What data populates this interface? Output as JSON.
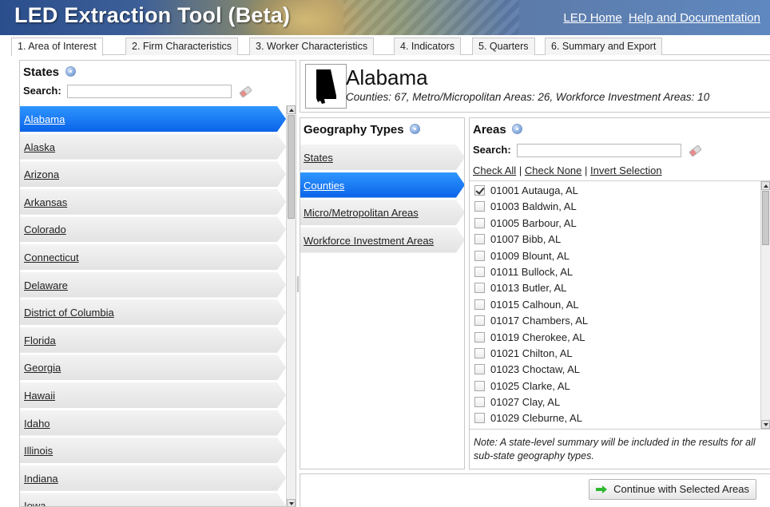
{
  "app": {
    "title": "LED Extraction Tool (Beta)",
    "links": [
      {
        "label": "LED Home"
      },
      {
        "label": "Help and Documentation"
      }
    ]
  },
  "tabs": [
    {
      "label": "1. Area of Interest",
      "active": true
    },
    {
      "label": "2. Firm Characteristics",
      "active": false
    },
    {
      "label": "3. Worker Characteristics",
      "active": false
    },
    {
      "label": "4. Indicators",
      "active": false
    },
    {
      "label": "5. Quarters",
      "active": false
    },
    {
      "label": "6. Summary and Export",
      "active": false
    }
  ],
  "states_panel": {
    "title": "States",
    "search_label": "Search:",
    "search_value": "",
    "items": [
      {
        "label": "Alabama",
        "selected": true
      },
      {
        "label": "Alaska",
        "selected": false
      },
      {
        "label": "Arizona",
        "selected": false
      },
      {
        "label": "Arkansas",
        "selected": false
      },
      {
        "label": "Colorado",
        "selected": false
      },
      {
        "label": "Connecticut",
        "selected": false
      },
      {
        "label": "Delaware",
        "selected": false
      },
      {
        "label": "District of Columbia",
        "selected": false
      },
      {
        "label": "Florida",
        "selected": false
      },
      {
        "label": "Georgia",
        "selected": false
      },
      {
        "label": "Hawaii",
        "selected": false
      },
      {
        "label": "Idaho",
        "selected": false
      },
      {
        "label": "Illinois",
        "selected": false
      },
      {
        "label": "Indiana",
        "selected": false
      },
      {
        "label": "Iowa",
        "selected": false
      }
    ]
  },
  "selected_state": {
    "name": "Alabama",
    "meta": "Counties: 67, Metro/Micropolitan Areas: 26, Workforce Investment Areas: 10"
  },
  "geography_types": {
    "title": "Geography Types",
    "items": [
      {
        "label": "States",
        "selected": false
      },
      {
        "label": "Counties",
        "selected": true
      },
      {
        "label": "Micro/Metropolitan Areas",
        "selected": false
      },
      {
        "label": "Workforce Investment Areas",
        "selected": false
      }
    ]
  },
  "areas_panel": {
    "title": "Areas",
    "search_label": "Search:",
    "search_value": "",
    "check_all": "Check All",
    "check_none": "Check None",
    "invert": "Invert Selection",
    "separator": "|",
    "items": [
      {
        "label": "01001 Autauga, AL",
        "checked": true
      },
      {
        "label": "01003 Baldwin, AL",
        "checked": false
      },
      {
        "label": "01005 Barbour, AL",
        "checked": false
      },
      {
        "label": "01007 Bibb, AL",
        "checked": false
      },
      {
        "label": "01009 Blount, AL",
        "checked": false
      },
      {
        "label": "01011 Bullock, AL",
        "checked": false
      },
      {
        "label": "01013 Butler, AL",
        "checked": false
      },
      {
        "label": "01015 Calhoun, AL",
        "checked": false
      },
      {
        "label": "01017 Chambers, AL",
        "checked": false
      },
      {
        "label": "01019 Cherokee, AL",
        "checked": false
      },
      {
        "label": "01021 Chilton, AL",
        "checked": false
      },
      {
        "label": "01023 Choctaw, AL",
        "checked": false
      },
      {
        "label": "01025 Clarke, AL",
        "checked": false
      },
      {
        "label": "01027 Clay, AL",
        "checked": false
      },
      {
        "label": "01029 Cleburne, AL",
        "checked": false
      }
    ],
    "note": "Note: A state-level summary will be included in the results for all sub-state geography types."
  },
  "actions": {
    "continue_label": "Continue with Selected Areas"
  },
  "icons": {
    "help": "help-icon",
    "eraser": "eraser-icon",
    "continue": "arrow-right-icon"
  },
  "colors": {
    "selected_item": "#1a78f2",
    "continue_arrow": "#2eb82e"
  }
}
